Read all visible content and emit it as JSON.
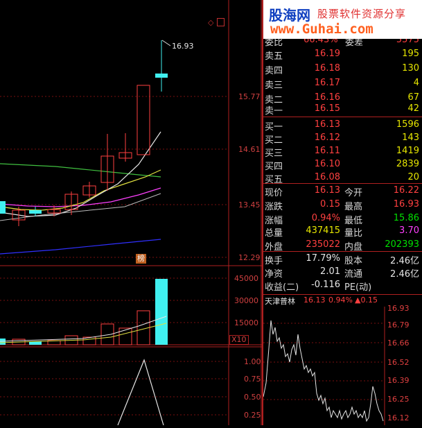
{
  "watermark": {
    "cn": "股海网",
    "sub": "股票软件资源分享",
    "url": "www.Guhai.com"
  },
  "chart": {
    "peak_label": "16.93",
    "price_ticks": [
      "15.77",
      "14.61",
      "13.45",
      "12.29"
    ],
    "badge": "榜",
    "vol_ticks": [
      "45000",
      "30000",
      "15000"
    ],
    "vol_mult": "X10",
    "ind_ticks": [
      "1.00",
      "0.75",
      "0.50",
      "0.25"
    ]
  },
  "orderbook": {
    "top": {
      "label": "委比",
      "value": "66.43%",
      "label2": "委差",
      "value2": "5575"
    },
    "asks": [
      {
        "label": "卖五",
        "price": "16.19",
        "vol": "195"
      },
      {
        "label": "卖四",
        "price": "16.18",
        "vol": "130"
      },
      {
        "label": "卖三",
        "price": "16.17",
        "vol": "4"
      },
      {
        "label": "卖二",
        "price": "16.16",
        "vol": "67"
      },
      {
        "label": "卖一",
        "price": "16.15",
        "vol": "42"
      }
    ],
    "bids": [
      {
        "label": "买一",
        "price": "16.13",
        "vol": "1596"
      },
      {
        "label": "买二",
        "price": "16.12",
        "vol": "143"
      },
      {
        "label": "买三",
        "price": "16.11",
        "vol": "1419"
      },
      {
        "label": "买四",
        "price": "16.10",
        "vol": "2839"
      },
      {
        "label": "买五",
        "price": "16.08",
        "vol": "20"
      }
    ]
  },
  "stats": {
    "r1": {
      "l1": "现价",
      "v1": "16.13",
      "l2": "今开",
      "v2": "16.22"
    },
    "r2": {
      "l1": "涨跌",
      "v1": "0.15",
      "l2": "最高",
      "v2": "16.93"
    },
    "r3": {
      "l1": "涨幅",
      "v1": "0.94%",
      "l2": "最低",
      "v2": "15.86"
    },
    "r4": {
      "l1": "总量",
      "v1": "437415",
      "l2": "量比",
      "v2": "3.70"
    },
    "r5": {
      "l1": "外盘",
      "v1": "235022",
      "l2": "内盘",
      "v2": "202393"
    },
    "r6": {
      "l1": "换手",
      "v1": "17.79%",
      "l2": "股本",
      "v2": "2.46亿"
    },
    "r7": {
      "l1": "净资",
      "v1": "2.01",
      "l2": "流通",
      "v2": "2.46亿"
    },
    "r8": {
      "l1": "收益(二)",
      "v1": "-0.116",
      "l2": "PE(动)",
      "v2": ""
    }
  },
  "mini": {
    "name": "天津普林",
    "price": "16.13",
    "pct": "0.94%",
    "chg": "▲0.15",
    "ticks": [
      "16.93",
      "16.79",
      "16.66",
      "16.52",
      "16.39",
      "16.25",
      "16.12"
    ]
  },
  "colors": {
    "up": "#ff4040",
    "down": "#00e000",
    "cyan": "#40f0f0",
    "grid": "#7a1010"
  }
}
